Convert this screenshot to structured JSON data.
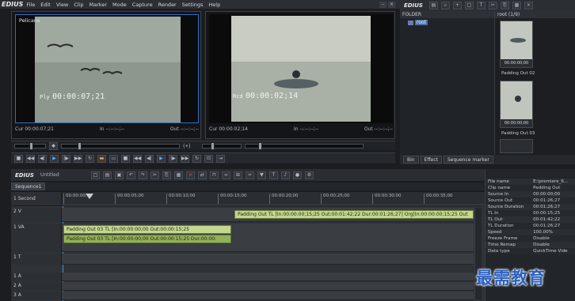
{
  "app": {
    "name": "EDIUS"
  },
  "menu": [
    "File",
    "Edit",
    "View",
    "Clip",
    "Marker",
    "Mode",
    "Capture",
    "Render",
    "Settings",
    "Help"
  ],
  "player": {
    "clip_label": "Pelicans",
    "mode": "Ply",
    "timecode": "00:00:07;21",
    "cur": "Cur 00:00:07;21",
    "in": "In --:--:--;--",
    "out": "Out --:--:--;--"
  },
  "recorder": {
    "mode": "Rcd",
    "timecode": "00:00:02;14",
    "cur": "Cur 00:00:02;14",
    "in": "In --:--:--;--",
    "out": "Out --:--:--;--"
  },
  "bin": {
    "title": "EDIUS",
    "folder_label": "FOLDER",
    "root_label": "root",
    "root_tab": "root (1/9)",
    "thumbs": [
      {
        "caption": "Padding Out 02",
        "timecode": "00:00:00;00"
      },
      {
        "caption": "Padding Out 03",
        "timecode": "00:00:00;00"
      }
    ],
    "tabs": [
      "Bin",
      "Effect",
      "Sequence marker"
    ]
  },
  "timeline": {
    "title": "EDIUS",
    "project": "Untitled",
    "sequence_tab": "Sequence1",
    "scale": "1 Second",
    "ruler": [
      "00:00:00;00",
      "00:00:05;00",
      "00:00:10;00",
      "00:00:15;00",
      "00:00:20;00",
      "00:00:25;00",
      "00:00:30;00",
      "00:00:35;00"
    ],
    "tracks": [
      {
        "name": "2 V"
      },
      {
        "name": "1 VA"
      },
      {
        "name": "1 T"
      },
      {
        "name": "1 A"
      },
      {
        "name": "2 A"
      },
      {
        "name": "3 A"
      }
    ],
    "clip_v2": "Padding Out  TL [In:00:00:00;15;25 Out:00:01:42;22 Dur:00:01:26;27]  Org[In:00:00:00;15;25 Out",
    "clip_va_video": "Padding Out 03  TL [In:00:00:00;00 Out:00:00:15;25",
    "clip_va_audio": "Padding Out 03  TL [In:00:00:00;00 Out:00:00:15;25 Dur:00:00:"
  },
  "properties": [
    [
      "File name",
      "E:\\premiere_6..."
    ],
    [
      "Clip name",
      "Padding Out"
    ],
    [
      "Source In",
      "00:00:00;00"
    ],
    [
      "Source Out",
      "00:01:26;27"
    ],
    [
      "Source Duration",
      "00:01:26;27"
    ],
    [
      "TL In",
      "00:00:15;25"
    ],
    [
      "TL Out",
      "00:01:42;22"
    ],
    [
      "TL Duration",
      "00:01:26;27"
    ],
    [
      "Speed",
      "100.00%"
    ],
    [
      "Freeze Frame",
      "Disable"
    ],
    [
      "Time Remap",
      "Disable"
    ],
    [
      "Data type",
      "QuickTime Vide"
    ]
  ],
  "watermark": "最需教育",
  "colors": {
    "accent": "#4a90d0",
    "clip_green": "#8fae52",
    "clip_green_light": "#c0d88a"
  }
}
